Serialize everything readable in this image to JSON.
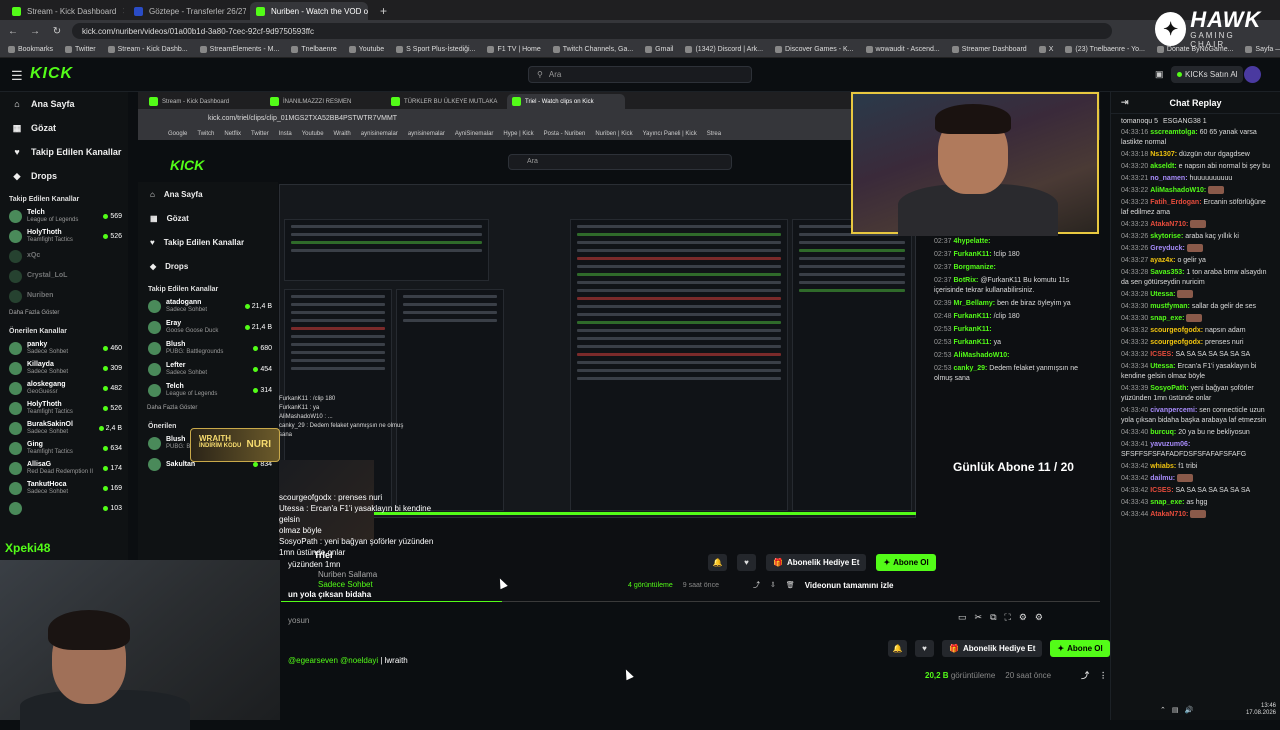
{
  "browser": {
    "tabs": [
      {
        "label": "Stream - Kick Dashboard",
        "active": false
      },
      {
        "label": "Göztepe - Transferler 26/27 | Tr...",
        "active": false
      },
      {
        "label": "Nuriben - Watch the VOD on K...",
        "active": true
      }
    ],
    "url": "kick.com/nuriben/videos/01a00b1d-3a80-7cec-92cf-9d9750593ffc",
    "bookmarks": [
      "Bookmarks",
      "Twitter",
      "Stream - Kick Dashb...",
      "StreamElements - M...",
      "Tnelbaenre",
      "Youtube",
      "S Sport Plus-İstediği...",
      "F1 TV | Home",
      "Twitch Channels, Ga...",
      "Gmail",
      "(1342) Discord | Ark...",
      "Discover Games - K...",
      "wowaudit - Ascend...",
      "Streamer Dashboard",
      "X",
      "(23) Tnelbaenre - Yo...",
      "Donate ByNoGame...",
      "Sayfa — hits.co"
    ]
  },
  "hawk": {
    "title": "HAWK",
    "subtitle": "GAMING CHAIR"
  },
  "site": {
    "logo": "KICK",
    "search_placeholder": "Ara",
    "buy_kicks": "KICKs Satın Al"
  },
  "sidebar": {
    "nav": [
      {
        "label": "Ana Sayfa",
        "icon": "home-icon",
        "glyph": "⌂"
      },
      {
        "label": "Gözat",
        "icon": "browse-icon",
        "glyph": "▦"
      },
      {
        "label": "Takip Edilen Kanallar",
        "icon": "heart-icon",
        "glyph": "♥"
      },
      {
        "label": "Drops",
        "icon": "drops-icon",
        "glyph": "◆"
      }
    ],
    "followed_title": "Takip Edilen Kanallar",
    "followed": [
      {
        "name": "Telch",
        "game": "League of Legends",
        "viewers": "569"
      },
      {
        "name": "HolyThoth",
        "game": "Teamfight Tactics",
        "viewers": "526"
      },
      {
        "name": "xQc",
        "game": "",
        "viewers": ""
      },
      {
        "name": "Crystal_LoL",
        "game": "",
        "viewers": ""
      },
      {
        "name": "Nuriben",
        "game": "",
        "viewers": ""
      }
    ],
    "show_more": "Daha Fazla Göster",
    "recommended_title": "Önerilen Kanallar",
    "recommended": [
      {
        "name": "panky",
        "game": "Sadece Sohbet",
        "viewers": "460"
      },
      {
        "name": "Killayda",
        "game": "Sadece Sohbet",
        "viewers": "309"
      },
      {
        "name": "aloskegang",
        "game": "GeoGuessr",
        "viewers": "482"
      },
      {
        "name": "HolyThoth",
        "game": "Teamfight Tactics",
        "viewers": "526"
      },
      {
        "name": "BurakSakinOl",
        "game": "Sadece Sohbet",
        "viewers": "2,4 B"
      },
      {
        "name": "Ging",
        "game": "Teamfight Tactics",
        "viewers": "634"
      },
      {
        "name": "AllisaG",
        "game": "Red Dead Redemption II",
        "viewers": "174"
      },
      {
        "name": "TankutHoca",
        "game": "Sadece Sohbet",
        "viewers": "169"
      },
      {
        "name": "",
        "game": "",
        "viewers": "103"
      }
    ]
  },
  "inner": {
    "tabs": [
      "Stream - Kick Dashboard",
      "İNANILMAZZZI RESMEN",
      "TÜRKLER BU ÜLKEYE MUTLAKA",
      "Triel - Watch clips on Kick"
    ],
    "url": "kick.com/triel/clips/clip_01MGS2TXA52BB4PSTWTR7VMMT",
    "bookmarks": [
      "Google",
      "Twitch",
      "Netflix",
      "Twitter",
      "Insta",
      "Youtube",
      "Wraith",
      "aynisinemalar",
      "aynisinemalar",
      "AyniSinemalar",
      "Hype | Kick",
      "Posta - Nuriben",
      "Nuriben | Kick",
      "Yayıncı Paneli | Kick",
      "Strea"
    ],
    "search_placeholder": "Ara",
    "nav": [
      "Ana Sayfa",
      "Gözat",
      "Takip Edilen Kanallar",
      "Drops"
    ],
    "followed_title": "Takip Edilen Kanallar",
    "followed": [
      {
        "name": "atadogann",
        "game": "Sadece Sohbet",
        "viewers": "21,4 B"
      },
      {
        "name": "Eray",
        "game": "Goose Goose Duck",
        "viewers": "21,4 B"
      },
      {
        "name": "Blush",
        "game": "PUBG: Battlegrounds",
        "viewers": "680"
      },
      {
        "name": "Lefter",
        "game": "Sadece Sohbet",
        "viewers": "454"
      },
      {
        "name": "Telch",
        "game": "League of Legends",
        "viewers": "314"
      }
    ],
    "recommended": [
      {
        "name": "Blush",
        "game": "PUBG: Battlegrounds",
        "viewers": "670"
      },
      {
        "name": "Sakultan",
        "game": "",
        "viewers": "834"
      }
    ],
    "show_more": "Daha Fazla Göster",
    "recommended_title": "Önerilen",
    "wraith": [
      "WRAITH",
      "İNDİRİM KODU",
      "NURI"
    ],
    "overlay_chat": [
      "FurkanK11 : /clip 180",
      "FurkanK11 : ya",
      "AliMashadoW10 : ...",
      "canky_29 : Dedem felaket yanmışsın ne olmuş",
      "sana"
    ],
    "overlay_lower": [
      "scourgeofgodx : prenses nuri",
      "Utessa : Ercan'a F1'i yasaklayın bi kendine gelsin",
      "olmaz böyle",
      "SosyoPath : yeni bağyan şoförler yüzünden 1mn üstünde onlar"
    ],
    "video_chat": [
      {
        "time": "02:37",
        "user": "4hypelatte:",
        "text": ""
      },
      {
        "time": "02:37",
        "user": "FurkanK11:",
        "text": "!clip 180"
      },
      {
        "time": "02:37",
        "user": "Borgmanize:",
        "text": ""
      },
      {
        "time": "02:37",
        "user": "BotRix:",
        "text": "@FurkanK11 Bu komutu 11s içerisinde tekrar kullanabilirsiniz."
      },
      {
        "time": "02:39",
        "user": "Mr_Bellamy:",
        "text": "ben de biraz öyleyim ya"
      },
      {
        "time": "02:48",
        "user": "FurkanK11:",
        "text": "/clip 180"
      },
      {
        "time": "02:53",
        "user": "FurkanK11:",
        "text": ""
      },
      {
        "time": "02:53",
        "user": "FurkanK11:",
        "text": "ya"
      },
      {
        "time": "02:53",
        "user": "AliMashadoW10:",
        "text": ""
      },
      {
        "time": "02:53",
        "user": "canky_29:",
        "text": "Dedem felaket yanmışsın ne olmuş sana"
      }
    ],
    "daily_sub": "Günlük Abone 11 / 20",
    "clip_user": "Triel",
    "clip_lines": [
      "yüzünden 1mn",
      "Nuriben Sallama",
      "Sadece Sohbet",
      "un yola çıksan bidaha"
    ],
    "gift_label": "Abonelik Hediye Et",
    "sub_label": "Abone Ol",
    "views": "4 görüntüleme",
    "time_ago": "9 saat önce",
    "watch_full": "Videonun tamamını izle"
  },
  "video": {
    "progress": 0.27,
    "below_title": "yosun",
    "gift_label": "Abonelik Hediye Et",
    "sub_label": "Abone Ol",
    "views": "20,2 B",
    "views_suffix": "görüntüleme",
    "time_ago": "20 saat önce",
    "mentions": [
      "@egearseven",
      "@noeldayi",
      "| lwraith"
    ]
  },
  "overlay": {
    "username": "Xpeki48"
  },
  "chat": {
    "title": "Chat Replay",
    "pinned": [
      {
        "user": "tomanoqu",
        "count": "5"
      },
      {
        "user": "ESGANG38",
        "count": "1"
      }
    ],
    "messages": [
      {
        "time": "04:33:16",
        "user": "sscreamtolga:",
        "color": "#53fc18",
        "text": "60 65 yanak varsa lastikte normal"
      },
      {
        "time": "04:33:18",
        "user": "Ns1307:",
        "color": "#f1c40f",
        "text": "düzgün otur dgagdsew"
      },
      {
        "time": "04:33:20",
        "user": "akseldt:",
        "color": "#53fc18",
        "text": "e napsın abi normal bi şey bu"
      },
      {
        "time": "04:33:21",
        "user": "no_namen:",
        "color": "#a78bfa",
        "text": "huuuuuuuuuu"
      },
      {
        "time": "04:33:22",
        "user": "AliMashadoW10:",
        "color": "#53fc18",
        "text": ""
      },
      {
        "time": "04:33:23",
        "user": "Fatih_Erdogan:",
        "color": "#e74c3c",
        "text": "Ercanin söförlüğüne laf edilmez ama"
      },
      {
        "time": "04:33:23",
        "user": "AtakaN710:",
        "color": "#e74c3c",
        "text": ""
      },
      {
        "time": "04:33:26",
        "user": "skytorise:",
        "color": "#53fc18",
        "text": "araba kaç yıllık ki"
      },
      {
        "time": "04:33:26",
        "user": "Greyduck:",
        "color": "#a78bfa",
        "text": ""
      },
      {
        "time": "04:33:27",
        "user": "ayaz4x:",
        "color": "#f1c40f",
        "text": "o gelir ya"
      },
      {
        "time": "04:33:28",
        "user": "Savas353:",
        "color": "#53fc18",
        "text": "1 ton araba bmw alsaydın da sen götürseydin nuricim"
      },
      {
        "time": "04:33:28",
        "user": "Utessa:",
        "color": "#53fc18",
        "text": ""
      },
      {
        "time": "04:33:30",
        "user": "mustfyman:",
        "color": "#53fc18",
        "text": "sallar da gelir de ses"
      },
      {
        "time": "04:33:30",
        "user": "snap_exe:",
        "color": "#53fc18",
        "text": ""
      },
      {
        "time": "04:33:32",
        "user": "scourgeofgodx:",
        "color": "#f1c40f",
        "text": "napsın adam"
      },
      {
        "time": "04:33:32",
        "user": "scourgeofgodx:",
        "color": "#f1c40f",
        "text": "prenses nuri"
      },
      {
        "time": "04:33:32",
        "user": "ICSES:",
        "color": "#e74c3c",
        "text": "SA SA SA SA SA SA SA"
      },
      {
        "time": "04:33:34",
        "user": "Utessa:",
        "color": "#53fc18",
        "text": "Ercan'a F1'i yasaklayın bi kendine gelsin olmaz böyle"
      },
      {
        "time": "04:33:39",
        "user": "SosyoPath:",
        "color": "#53fc18",
        "text": "yeni bağyan şoförler yüzünden 1mn üstünde onlar"
      },
      {
        "time": "04:33:40",
        "user": "civanpercemi:",
        "color": "#a78bfa",
        "text": "sen connecticle uzun yola çıksan bidaha başka arabaya laf etmezsin"
      },
      {
        "time": "04:33:40",
        "user": "burcuq:",
        "color": "#53fc18",
        "text": "20 ya bu ne bekliyosun"
      },
      {
        "time": "04:33:41",
        "user": "yavuzum06:",
        "color": "#a78bfa",
        "text": "SFSFFSFSFAFADFDSFSFAFAFSFAFG"
      },
      {
        "time": "04:33:42",
        "user": "whiabs:",
        "color": "#f1c40f",
        "text": "f1 tribi"
      },
      {
        "time": "04:33:42",
        "user": "dailmu:",
        "color": "#a78bfa",
        "text": ""
      },
      {
        "time": "04:33:42",
        "user": "ICSES:",
        "color": "#e74c3c",
        "text": "SA SA SA SA SA SA SA"
      },
      {
        "time": "04:33:43",
        "user": "snap_exe:",
        "color": "#53fc18",
        "text": "as hgg"
      },
      {
        "time": "04:33:44",
        "user": "AtakaN710:",
        "color": "#e74c3c",
        "text": ""
      }
    ]
  },
  "taskbar": {
    "time": "13:46",
    "date": "17.08.2026"
  }
}
